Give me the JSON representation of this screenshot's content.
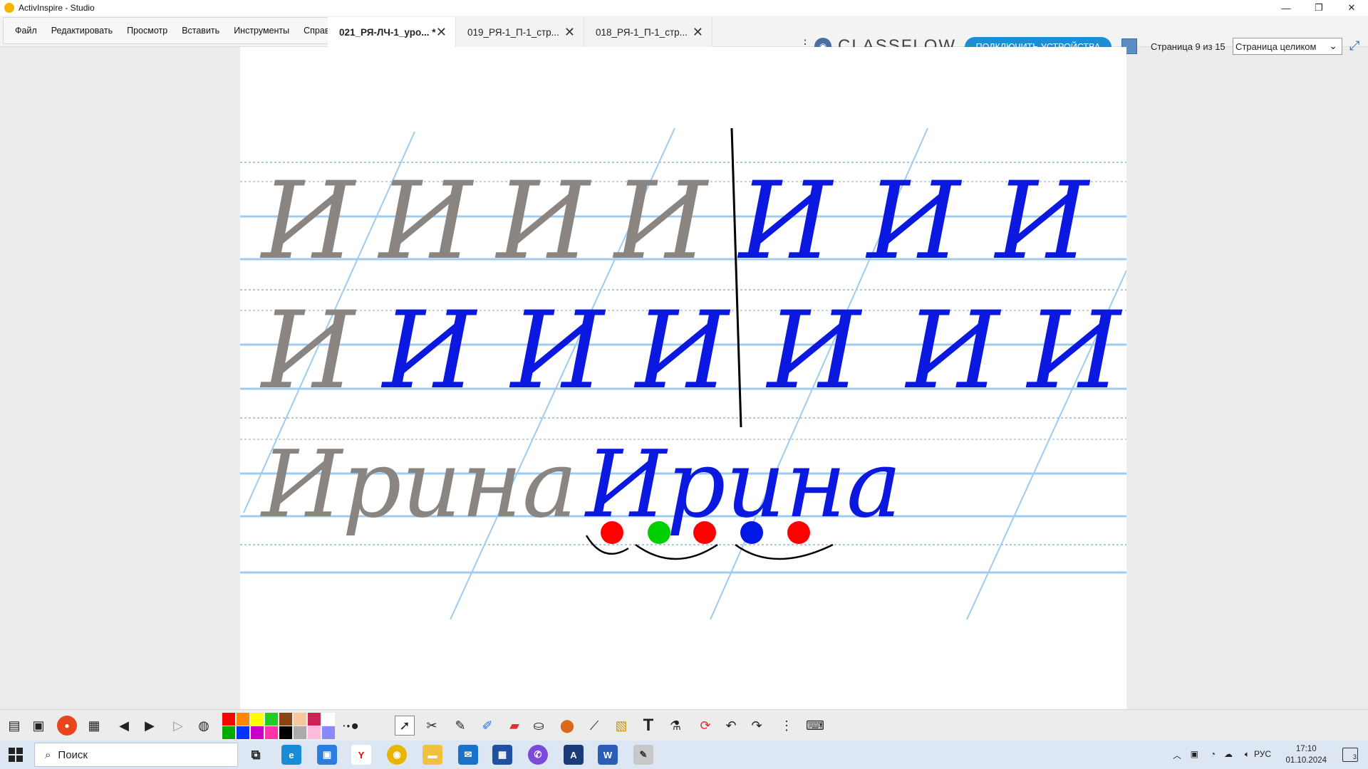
{
  "window": {
    "title": "ActivInspire - Studio"
  },
  "menu": {
    "items": [
      "Файл",
      "Редактировать",
      "Просмотр",
      "Вставить",
      "Инструменты",
      "Справка"
    ]
  },
  "tabs": [
    {
      "label": "021_РЯ-ЛЧ-1_уро... *",
      "active": true
    },
    {
      "label": "019_РЯ-1_П-1_стр...",
      "active": false
    },
    {
      "label": "018_РЯ-1_П-1_стр...",
      "active": false
    }
  ],
  "classflow": {
    "logo": "CLASSFLOW",
    "connect_label": "ПОДКЛЮЧИТЬ УСТРОЙСТВА"
  },
  "page": {
    "counter": "Страница 9 из 15",
    "zoom": "Страница целиком"
  },
  "board": {
    "row1_printed": [
      "И",
      "И",
      "И",
      "И"
    ],
    "row1_handwritten": [
      "И",
      "И",
      "И"
    ],
    "row2_printed": [
      "И"
    ],
    "row2_handwritten": [
      "И",
      "И",
      "И",
      "И",
      "И",
      "И"
    ],
    "word_printed": "Ирина",
    "word_handwritten": "Ирина",
    "syllable_dots": [
      "#ff0000",
      "#00d000",
      "#ff0000",
      "#0018e6",
      "#ff0000"
    ]
  },
  "palette": [
    "#ff0000",
    "#ff8800",
    "#ffff00",
    "#22cc22",
    "#8b4513",
    "#f5c8a0",
    "#cc2255",
    "#ffffff",
    "#00aa00",
    "#0033ff",
    "#cc00cc",
    "#ff33aa",
    "#000000",
    "#aaaaaa",
    "#ffbbdd",
    "#8888ff"
  ],
  "taskbar": {
    "search_placeholder": "Поиск",
    "lang": "РУС",
    "time": "17:10",
    "date": "01.10.2024",
    "notif_count": "3"
  },
  "colors": {
    "ink_blue": "#0a18e0",
    "printed_gray": "#8a8580",
    "line_blue": "#9fcbf0"
  }
}
